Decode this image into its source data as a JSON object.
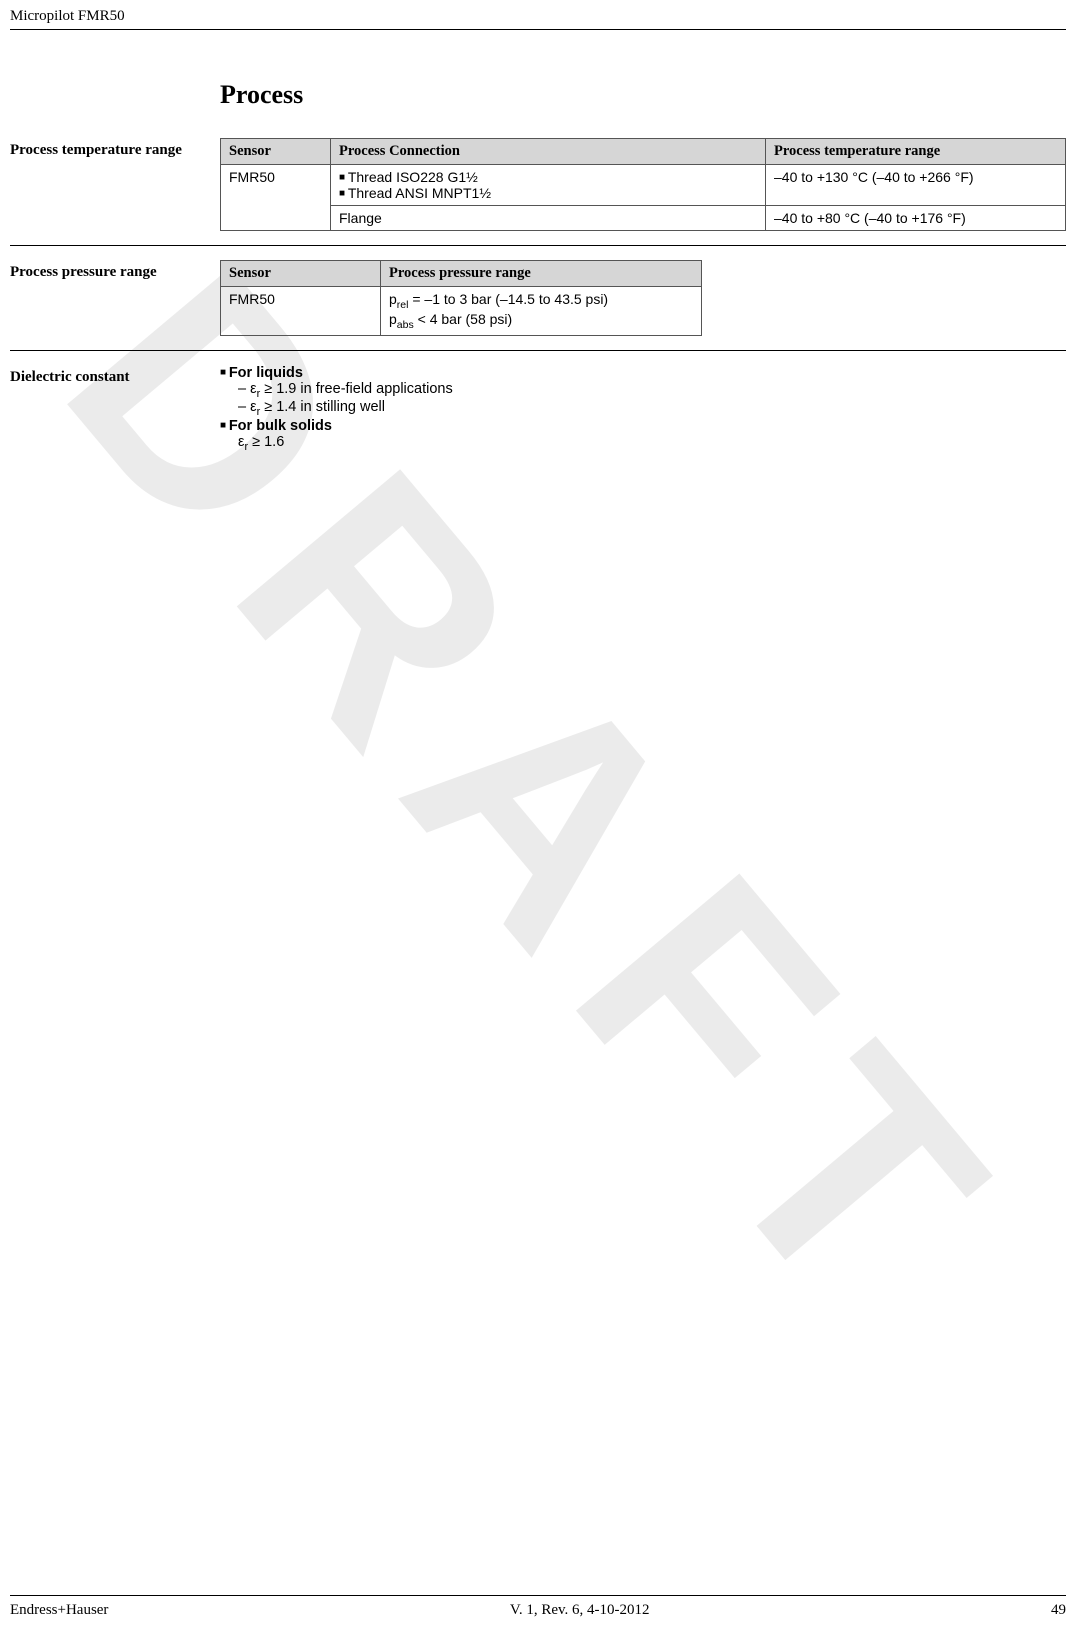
{
  "header": {
    "product": "Micropilot FMR50"
  },
  "watermark": "DRAFT",
  "section_title": "Process",
  "temp": {
    "sidehead": "Process temperature range",
    "headers": [
      "Sensor",
      "Process Connection",
      "Process temperature range"
    ],
    "sensor": "FMR50",
    "conn1a": "Thread ISO228 G1½",
    "conn1b": "Thread ANSI MNPT1½",
    "range1": "–40 to +130 °C (–40 to +266 °F)",
    "conn2": "Flange",
    "range2": "–40 to +80 °C (–40 to +176 °F)"
  },
  "press": {
    "sidehead": "Process pressure range",
    "headers": [
      "Sensor",
      "Process pressure range"
    ],
    "sensor": "FMR50",
    "line1_pre": "p",
    "line1_sub": "rel",
    "line1_post": " = –1 to 3 bar (–14.5 to 43.5 psi)",
    "line2_pre": "p",
    "line2_sub": "abs",
    "line2_post": " < 4 bar (58 psi)"
  },
  "diel": {
    "sidehead": "Dielectric constant",
    "liquids_label": "For liquids",
    "liq1_pre": "ε",
    "liq1_sub": "r",
    "liq1_post": " ≥ 1.9 in free-field applications",
    "liq2_pre": "ε",
    "liq2_sub": "r",
    "liq2_post": " ≥ 1.4 in stilling well",
    "solids_label": "For bulk solids",
    "sol_pre": "ε",
    "sol_sub": "r",
    "sol_post": " ≥ 1.6"
  },
  "footer": {
    "left": "Endress+Hauser",
    "center": "V. 1, Rev. 6, 4-10-2012",
    "right": "49"
  }
}
